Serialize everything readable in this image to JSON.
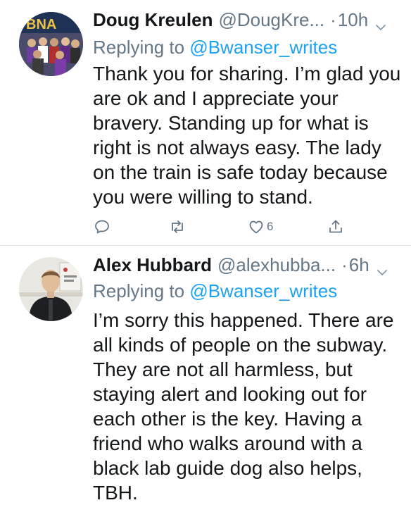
{
  "tweets": [
    {
      "name": "Doug Kreulen",
      "handle": "@DougKre...",
      "separator": "·",
      "time": "10h",
      "replying_prefix": "Replying to ",
      "replying_to": "@Bwanser_writes",
      "body_lines": [
        "Thank you for sharing. I’m glad you",
        "are ok and I appreciate your",
        "bravery. Standing up for what is",
        "right is not always easy. The lady",
        "on the train is safe today because",
        "you were willing to stand."
      ],
      "avatar_text": "BNA",
      "like_count": "6",
      "icons": [
        "reply-icon",
        "retweet-icon",
        "like-icon",
        "share-icon"
      ]
    },
    {
      "name": "Alex Hubbard",
      "handle": "@alexhubba...",
      "separator": "·",
      "time": "6h",
      "replying_prefix": "Replying to ",
      "replying_to": "@Bwanser_writes",
      "body_lines": [
        "I’m sorry this happened. There are",
        "all kinds of people on the subway.",
        "They are not all harmless, but",
        "staying alert and looking out for",
        "each other is the key. Having a",
        "friend who walks around with a",
        "black lab guide dog also helps,",
        "TBH."
      ]
    }
  ],
  "colors": {
    "text": "#14171a",
    "secondary": "#657786",
    "link": "#1da1f2",
    "divider": "#e1e8ed"
  }
}
